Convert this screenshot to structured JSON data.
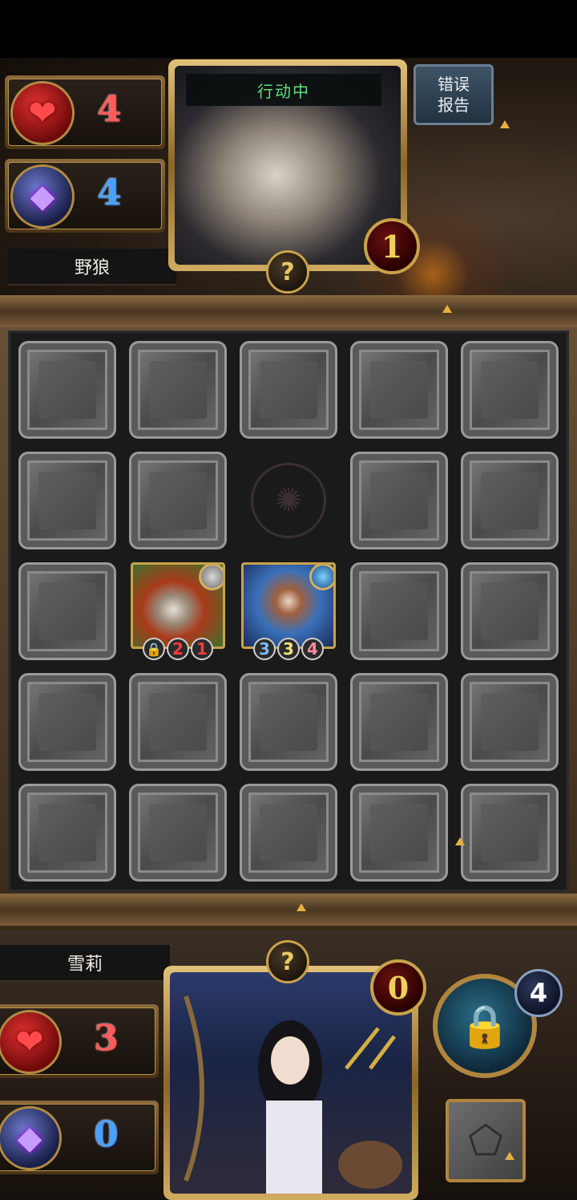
{
  "enemy": {
    "name": "野狼",
    "hp": "4",
    "mana": "4",
    "status": "行动中",
    "turn_counter": "1",
    "help": "?"
  },
  "player": {
    "name": "雪莉",
    "hp": "3",
    "mana": "0",
    "turn_counter": "0",
    "help": "?",
    "lock_count": "4"
  },
  "error_report_label": "错误\n报告",
  "board": {
    "rows": 5,
    "cols": 5,
    "center_rune": "✺",
    "units": [
      {
        "name": "wolf-unit-card",
        "row": 2,
        "col": 1,
        "stats": [
          "🔒",
          "2",
          "1"
        ],
        "stat_colors": [
          "lock",
          "red",
          "red"
        ]
      },
      {
        "name": "hunter-unit-card",
        "row": 2,
        "col": 2,
        "stats": [
          "3",
          "3",
          "4"
        ],
        "stat_colors": [
          "blue",
          "yellow",
          "pink"
        ]
      }
    ]
  },
  "icons": {
    "heart": "heart-icon",
    "crystal": "mana-crystal-icon",
    "lock": "padlock-icon",
    "pentagon": "pentagon-icon"
  },
  "colors": {
    "status_green": "#5fe07a",
    "hp_red": "#ff5a5a",
    "mana_blue": "#4aa0ff",
    "gold_frame": "#c9a24a"
  }
}
